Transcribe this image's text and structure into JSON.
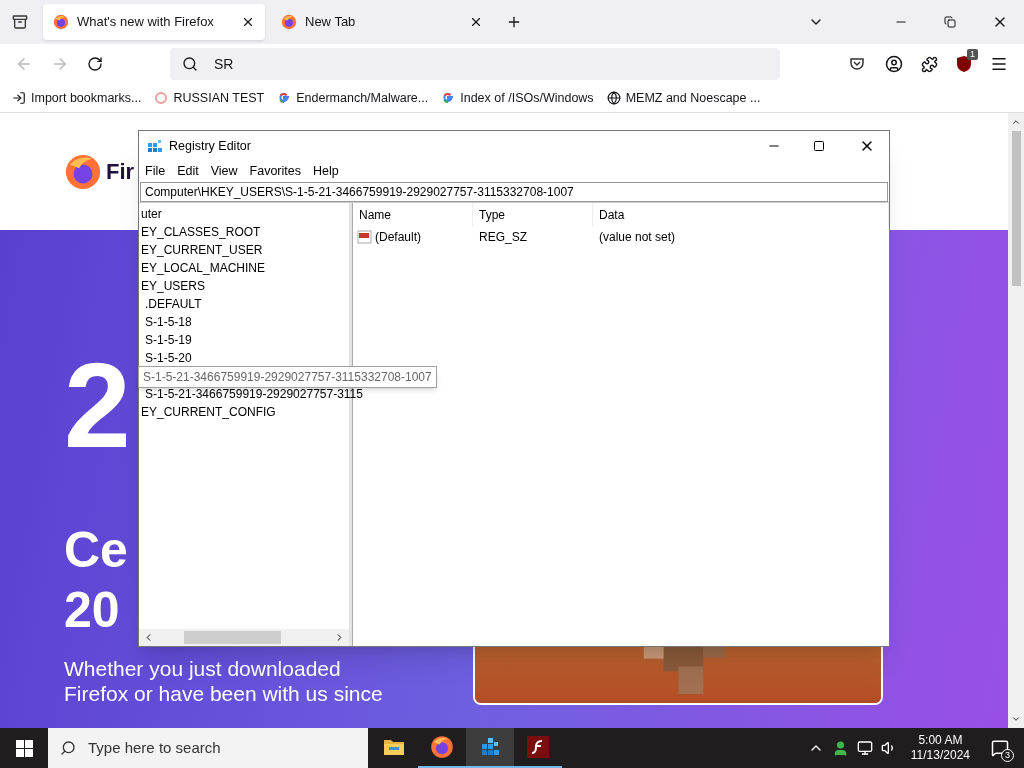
{
  "browser": {
    "tabs": [
      {
        "title": "What's new with Firefox",
        "selected": true
      },
      {
        "title": "New Tab",
        "selected": false
      }
    ],
    "address": {
      "value": "SR"
    },
    "extension_badge": "1",
    "bookmarks": [
      {
        "label": "Import bookmarks...",
        "kind": "import"
      },
      {
        "label": "RUSSIAN TEST",
        "kind": "page"
      },
      {
        "label": "Endermanch/Malware...",
        "kind": "google"
      },
      {
        "label": "Index of /ISOs/Windows",
        "kind": "google"
      },
      {
        "label": "MEMZ and Noescape ...",
        "kind": "globe"
      }
    ]
  },
  "page": {
    "brand": "Fir",
    "big_numeral": "2",
    "headline": [
      "Ce",
      "20"
    ],
    "paragraph_lines": [
      "Whether you just downloaded",
      "Firefox or have been with us since"
    ],
    "picture": {
      "kind": "picture"
    }
  },
  "regedit": {
    "title": "Registry Editor",
    "menu": [
      "File",
      "Edit",
      "View",
      "Favorites",
      "Help"
    ],
    "address": "Computer\\HKEY_USERS\\S-1-5-21-3466759919-2929027757-3115332708-1007",
    "tree": [
      {
        "label": "uter",
        "kind": "node",
        "children": [
          {
            "label": "EY_CLASSES_ROOT",
            "kind": "node"
          },
          {
            "label": "EY_CURRENT_USER",
            "kind": "node"
          },
          {
            "label": "EY_LOCAL_MACHINE",
            "kind": "node"
          },
          {
            "label": "EY_USERS",
            "kind": "node",
            "children": [
              {
                "label": ".DEFAULT",
                "kind": "node"
              },
              {
                "label": "S-1-5-18",
                "kind": "node"
              },
              {
                "label": "S-1-5-19",
                "kind": "node"
              },
              {
                "label": "S-1-5-20",
                "kind": "node"
              },
              {
                "label": "S-1-5-21-3466759919-2929027757-3115332708-1007",
                "kind": "tooltip"
              },
              {
                "label": "S-1-5-21-3466759919-2929027757-3115",
                "kind": "node"
              }
            ]
          },
          {
            "label": "EY_CURRENT_CONFIG",
            "kind": "node"
          }
        ]
      }
    ],
    "columns": [
      "Name",
      "Type",
      "Data"
    ],
    "rows": [
      {
        "name": "(Default)",
        "type": "REG_SZ",
        "data": "(value not set)"
      }
    ]
  },
  "taskbar": {
    "search_placeholder": "Type here to search",
    "apps": [
      {
        "kind": "folder",
        "running": false,
        "selected": false
      },
      {
        "kind": "browser",
        "running": true,
        "selected": false
      },
      {
        "kind": "registry",
        "running": true,
        "selected": true
      },
      {
        "kind": "flash",
        "running": true,
        "selected": false
      }
    ],
    "time": "5:00 AM",
    "date": "11/13/2024",
    "notifications": "3"
  }
}
